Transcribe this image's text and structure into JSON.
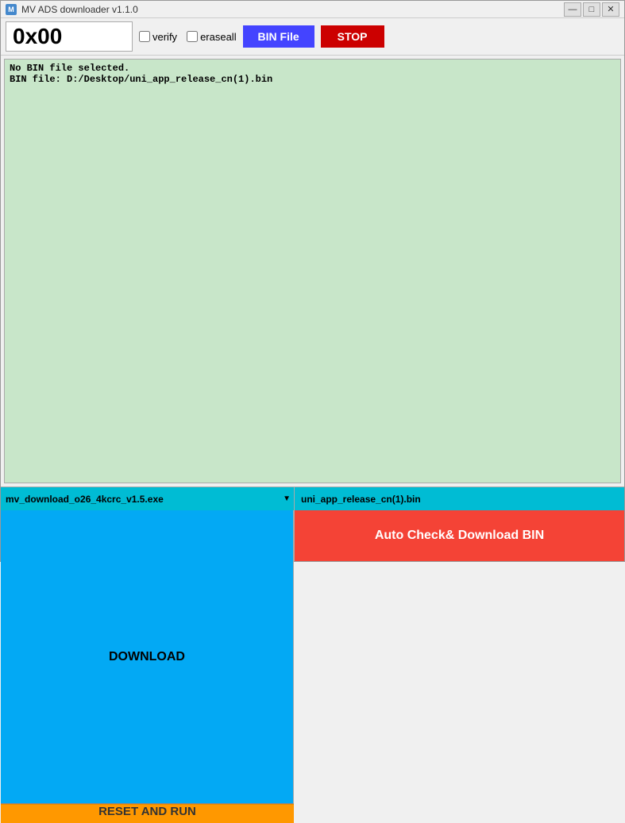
{
  "window": {
    "title": "MV ADS downloader v1.1.0",
    "icon": "M"
  },
  "toolbar": {
    "status_value": "0x00",
    "verify_label": "verify",
    "eraseall_label": "eraseall",
    "bin_file_label": "BIN File",
    "stop_label": "STOP",
    "verify_checked": false,
    "eraseall_checked": false
  },
  "log": {
    "lines": [
      "No BIN file selected.",
      "BIN file: D:/Desktop/uni_app_release_cn(1).bin"
    ]
  },
  "bottom": {
    "selected_exe": "mv_download_o26_4kcrc_v1.5.exe",
    "exe_options": [
      "mv_download_o26_4kcrc_v1.5.exe"
    ],
    "bin_filename": "uni_app_release_cn(1).bin",
    "download_label": "DOWNLOAD",
    "reset_run_label": "RESET AND RUN",
    "auto_check_line1": "Auto Check",
    "auto_check_line2": "& Download BIN"
  },
  "title_controls": {
    "minimize": "—",
    "maximize": "□",
    "close": "✕"
  }
}
